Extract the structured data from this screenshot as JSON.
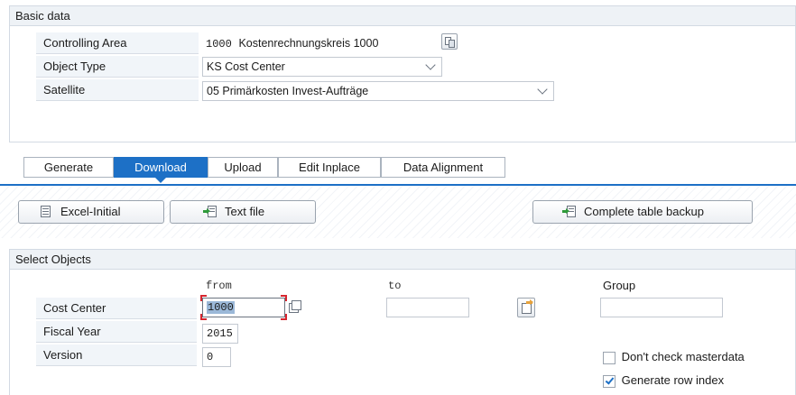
{
  "basic": {
    "title": "Basic data",
    "labels": [
      "Controlling Area",
      "Object Type",
      "Satellite"
    ],
    "controlling_area_code": "1000",
    "controlling_area_text": "Kostenrechnungskreis 1000",
    "object_type": "KS Cost Center",
    "satellite": "05 Primärkosten Invest-Aufträge"
  },
  "tabs": [
    "Generate",
    "Download",
    "Upload",
    "Edit Inplace",
    "Data Alignment"
  ],
  "active_tab": "Download",
  "buttons": {
    "excel": "Excel-Initial",
    "text_file": "Text file",
    "backup": "Complete table backup"
  },
  "select": {
    "title": "Select Objects",
    "col_from": "from",
    "col_to": "to",
    "col_group": "Group",
    "cost_center_label": "Cost Center",
    "cost_center_from": "1000",
    "fiscal_year_label": "Fiscal Year",
    "fiscal_year": "2015",
    "version_label": "Version",
    "version": "0",
    "dont_check_label": "Don't check masterdata",
    "dont_check": false,
    "row_index_label": "Generate row index",
    "row_index": true
  },
  "colors": {
    "accent": "#1d70c6",
    "section_bg": "#eef2f6",
    "border": "#d3dae3"
  }
}
